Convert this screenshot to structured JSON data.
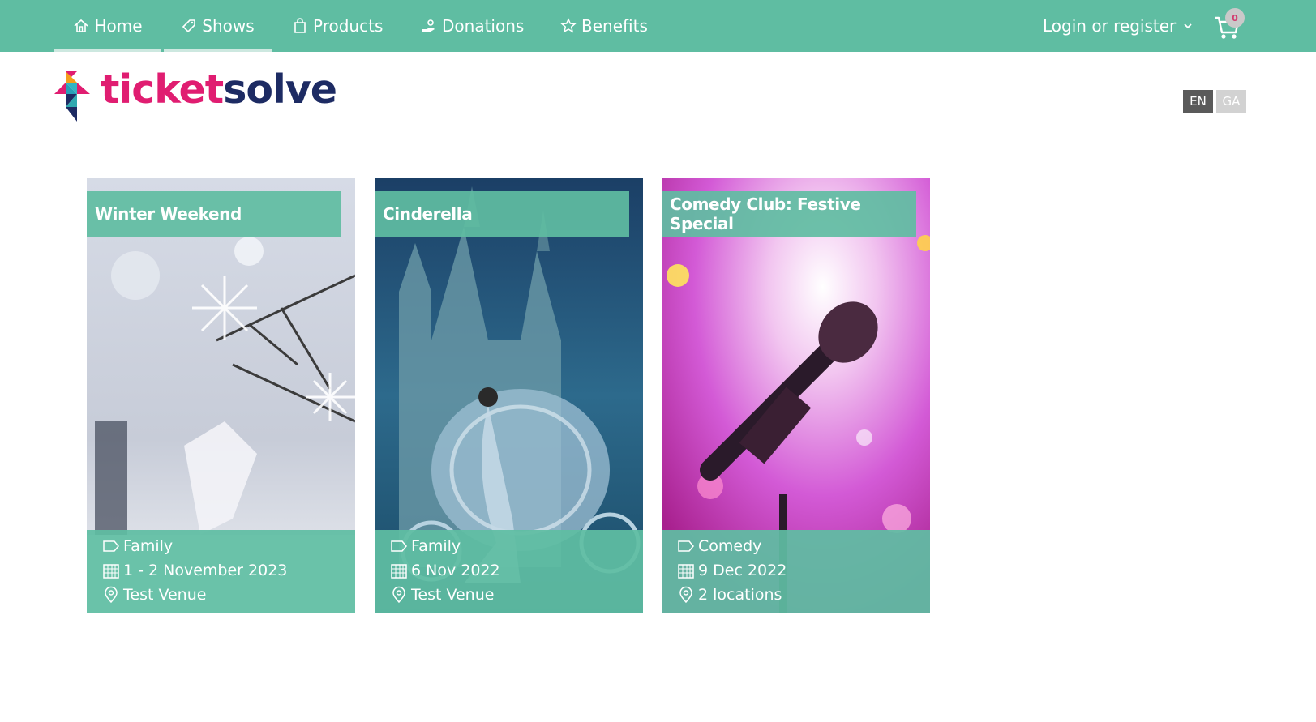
{
  "nav": {
    "items": [
      {
        "label": "Home",
        "icon": "home-icon"
      },
      {
        "label": "Shows",
        "icon": "tag-icon"
      },
      {
        "label": "Products",
        "icon": "bag-icon"
      },
      {
        "label": "Donations",
        "icon": "donation-icon"
      },
      {
        "label": "Benefits",
        "icon": "star-badge-icon"
      }
    ],
    "login_label": "Login or register",
    "cart_count": "0"
  },
  "brand": {
    "ticket": "ticket",
    "solve": "solve",
    "colors": {
      "pink": "#e01d71",
      "navy": "#1d2b63",
      "teal": "#5fbda2"
    }
  },
  "languages": [
    "EN",
    "GA"
  ],
  "shows": [
    {
      "title": "Winter Weekend",
      "category": "Family",
      "date": "1 - 2 November 2023",
      "venue": "Test Venue"
    },
    {
      "title": "Cinderella",
      "category": "Family",
      "date": "6 Nov 2022",
      "venue": "Test Venue"
    },
    {
      "title": "Comedy Club: Festive Special",
      "category": "Comedy",
      "date": "9 Dec 2022",
      "venue": "2 locations"
    }
  ]
}
